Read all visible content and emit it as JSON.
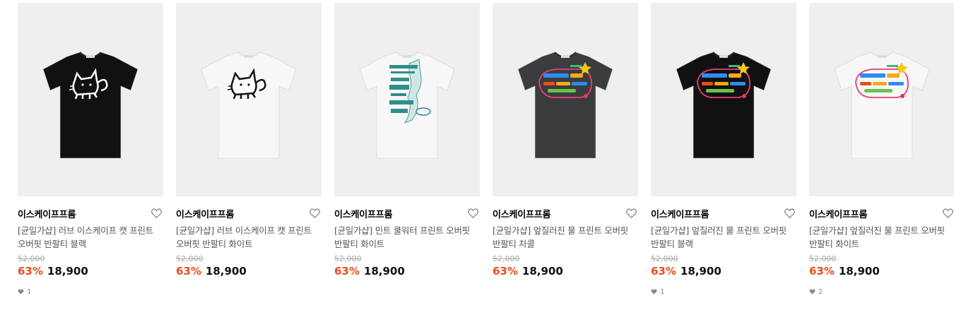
{
  "products": [
    {
      "brand": "이스케이프프롬",
      "title": "[균일가샵] 러브 이스케이프 캣 프린트 오버핏 반팔티 블랙",
      "original_price": "52,000",
      "discount": "63%",
      "price": "18,900",
      "likes": "1",
      "shirt_color": "#111111",
      "graphic": "cat"
    },
    {
      "brand": "이스케이프프롬",
      "title": "[균일가샵] 러브 이스케이프 캣 프린트 오버핏 반팔티 화이트",
      "original_price": "52,000",
      "discount": "63%",
      "price": "18,900",
      "likes": "",
      "shirt_color": "#f7f7f7",
      "graphic": "cat"
    },
    {
      "brand": "이스케이프프롬",
      "title": "[균일가샵] 민트 쿨워터 프린트 오버핏 반팔티 화이트",
      "original_price": "52,000",
      "discount": "63%",
      "price": "18,900",
      "likes": "",
      "shirt_color": "#f7f7f7",
      "graphic": "coolwater"
    },
    {
      "brand": "이스케이프프롬",
      "title": "[균일가샵] 엎질러진 물 프린트 오버핏 반팔티 차콜",
      "original_price": "52,000",
      "discount": "63%",
      "price": "18,900",
      "likes": "",
      "shirt_color": "#3b3c3e",
      "graphic": "spilled"
    },
    {
      "brand": "이스케이프프롬",
      "title": "[균일가샵] 엎질러진 물 프린트 오버핏 반팔티 블랙",
      "original_price": "52,000",
      "discount": "63%",
      "price": "18,900",
      "likes": "1",
      "shirt_color": "#111111",
      "graphic": "spilled"
    },
    {
      "brand": "이스케이프프롬",
      "title": "[균일가샵] 엎질러진 물 프린트 오버핏 반팔티 화이트",
      "original_price": "52,000",
      "discount": "63%",
      "price": "18,900",
      "likes": "2",
      "shirt_color": "#f7f7f7",
      "graphic": "spilled"
    }
  ],
  "icons": {
    "wishlist": "heart-outline-icon",
    "like_count": "heart-filled-icon"
  },
  "colors": {
    "discount": "#ee4c1d",
    "thumbnail_bg": "#efefef"
  }
}
